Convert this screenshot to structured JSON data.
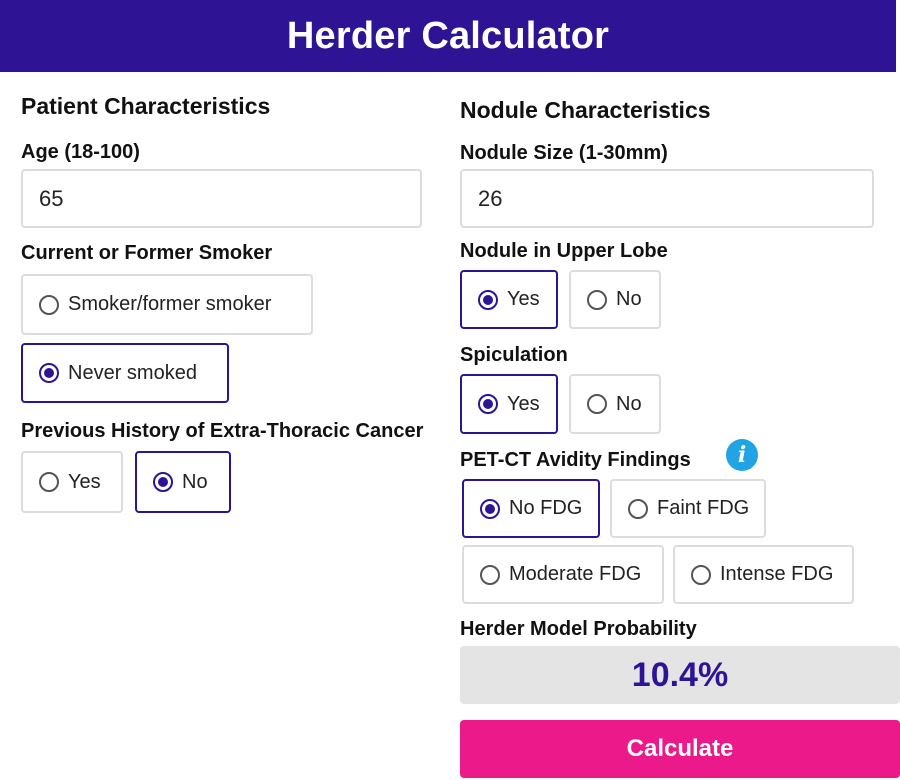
{
  "header": {
    "title": "Herder Calculator"
  },
  "patient": {
    "section_title": "Patient Characteristics",
    "age_label": "Age (18-100)",
    "age_value": "65",
    "smoker_label": "Current or Former Smoker",
    "smoker_options": [
      {
        "label": "Smoker/former smoker",
        "selected": false
      },
      {
        "label": "Never smoked",
        "selected": true
      }
    ],
    "history_label": "Previous History of Extra-Thoracic Cancer",
    "history_options": [
      {
        "label": "Yes",
        "selected": false
      },
      {
        "label": "No",
        "selected": true
      }
    ]
  },
  "nodule": {
    "section_title": "Nodule Characteristics",
    "size_label": "Nodule Size (1-30mm)",
    "size_value": "26",
    "upper_lobe_label": "Nodule in Upper Lobe",
    "upper_lobe_options": [
      {
        "label": "Yes",
        "selected": true
      },
      {
        "label": "No",
        "selected": false
      }
    ],
    "spiculation_label": "Spiculation",
    "spiculation_options": [
      {
        "label": "Yes",
        "selected": true
      },
      {
        "label": "No",
        "selected": false
      }
    ],
    "pet_label": "PET-CT Avidity Findings",
    "pet_info_icon": "info-icon",
    "pet_info_glyph": "i",
    "pet_options": [
      {
        "label": "No FDG",
        "selected": true
      },
      {
        "label": "Faint FDG",
        "selected": false
      },
      {
        "label": "Moderate FDG",
        "selected": false
      },
      {
        "label": "Intense FDG",
        "selected": false
      }
    ]
  },
  "result": {
    "label": "Herder Model Probability",
    "value": "10.4%"
  },
  "calculate_label": "Calculate",
  "colors": {
    "brand": "#2e1494",
    "accent": "#ec198b",
    "info": "#20a4e6"
  }
}
